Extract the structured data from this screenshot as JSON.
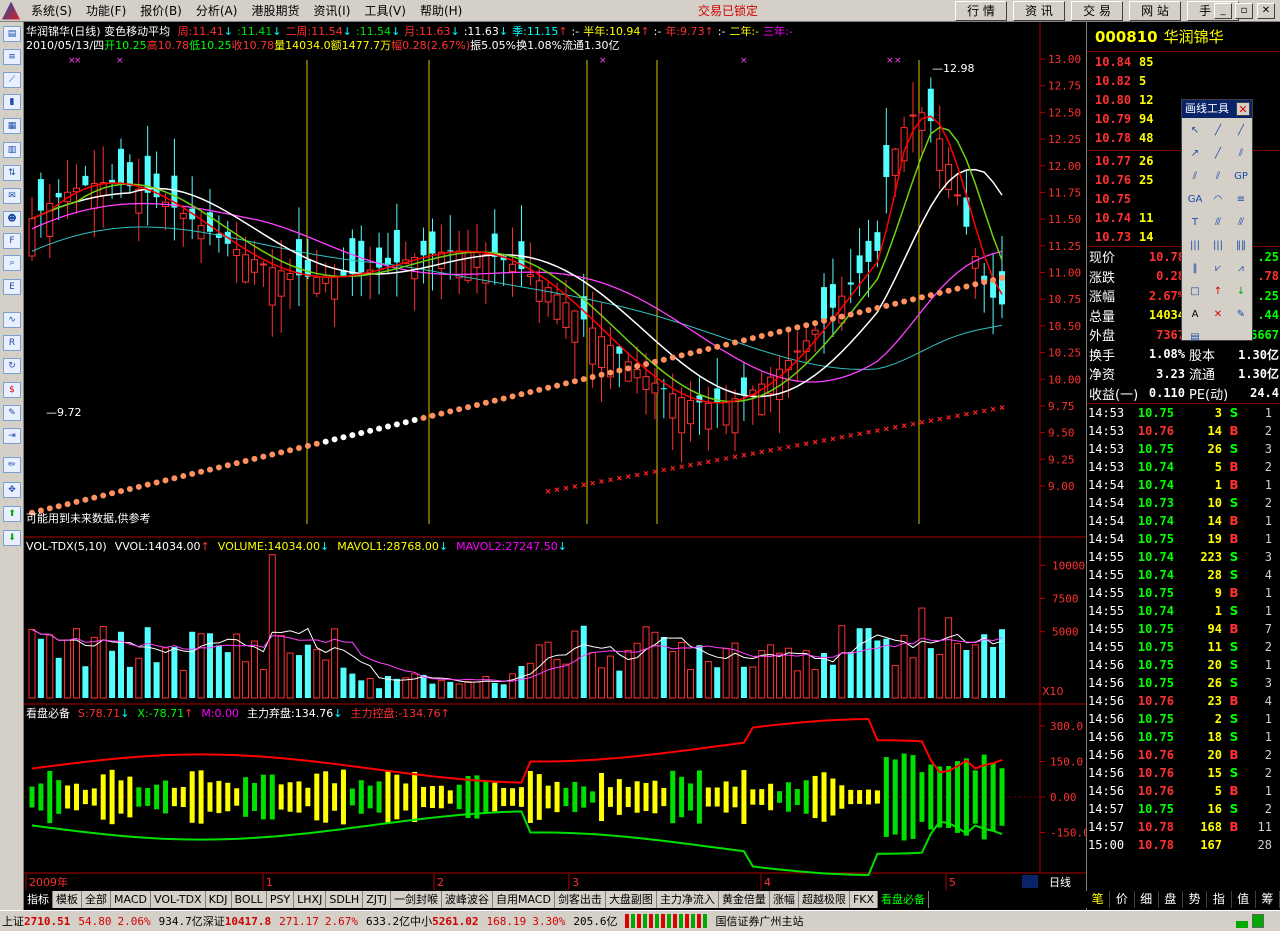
{
  "menu": {
    "items": [
      "系统(S)",
      "功能(F)",
      "报价(B)",
      "分析(A)",
      "港股期货",
      "资讯(I)",
      "工具(V)",
      "帮助(H)"
    ],
    "lock_status": "交易已锁定",
    "right_buttons": [
      "行 情",
      "资 讯",
      "交 易",
      "网 站",
      "手 机"
    ]
  },
  "toolbar_icons": [
    "quote-icon",
    "list-icon",
    "line-chart-icon",
    "candle-icon",
    "report-icon",
    "table-icon",
    "sort-icon",
    "mail-icon",
    "people-icon",
    "f10-icon",
    "zoom-icon",
    "etf-icon",
    "wave-icon",
    "rsi-icon",
    "refresh-icon",
    "dollar-icon",
    "wrench-icon",
    "exit-icon",
    "pencil-icon",
    "move-icon",
    "up-arrow-icon",
    "down-arrow-icon"
  ],
  "header": {
    "title": "华润锦华(日线)",
    "indicator_name": "变色移动平均",
    "ma_values": [
      {
        "label": "周:11.41",
        "color": "#ff3030",
        "arrow": "↓"
      },
      {
        "label": ":11.41",
        "color": "#00e000",
        "arrow": "↓"
      },
      {
        "label": "二周:11.54",
        "color": "#ff3030",
        "arrow": "↓"
      },
      {
        "label": ":11.54",
        "color": "#00e000",
        "arrow": "↓"
      },
      {
        "label": "月:11.63",
        "color": "#ff3030",
        "arrow": "↓"
      },
      {
        "label": ":11.63",
        "color": "#ffffff",
        "arrow": "↓"
      },
      {
        "label": "季:11.15",
        "color": "#00ffff",
        "arrow": "↑"
      },
      {
        "label": ":-",
        "color": "#ffffff",
        "arrow": ""
      },
      {
        "label": "半年:10.94",
        "color": "#ffff00",
        "arrow": "↑"
      },
      {
        "label": ":-",
        "color": "#ffffff",
        "arrow": ""
      },
      {
        "label": "年:9.73",
        "color": "#ff3030",
        "arrow": "↑"
      },
      {
        "label": ":-",
        "color": "#ffffff",
        "arrow": ""
      },
      {
        "label": "二年:-",
        "color": "#ffff00",
        "arrow": ""
      },
      {
        "label": "三年:-",
        "color": "#ff00ff",
        "arrow": ""
      }
    ],
    "info_line": "2010/05/13/四",
    "info_items": [
      {
        "label": "开10.25",
        "color": "#00ff00"
      },
      {
        "label": "高10.78",
        "color": "#ff3030"
      },
      {
        "label": "低10.25",
        "color": "#00ff00"
      },
      {
        "label": "收10.78",
        "color": "#ff3030"
      },
      {
        "label": "量14034.0",
        "color": "#ffff00"
      },
      {
        "label": "额1477.7万",
        "color": "#ffff00"
      },
      {
        "label": "幅0.28(2.67%)",
        "color": "#ff3030"
      },
      {
        "label": "振5.05%",
        "color": "#ffffff"
      },
      {
        "label": "换1.08%",
        "color": "#ffffff"
      },
      {
        "label": "流通1.30亿",
        "color": "#ffffff"
      }
    ]
  },
  "main_chart": {
    "y_ticks": [
      "13.00",
      "12.75",
      "12.50",
      "12.25",
      "12.00",
      "11.75",
      "11.50",
      "11.25",
      "11.00",
      "10.75",
      "10.50",
      "10.25",
      "10.00",
      "9.75",
      "9.50",
      "9.25",
      "9.00"
    ],
    "high_label": "12.98",
    "low_label": "9.72",
    "note": "可能用到未来数据,供参考"
  },
  "volume_chart": {
    "header": [
      {
        "label": "VOL-TDX(5,10)",
        "color": "#ffffff"
      },
      {
        "label": "VVOL:14034.00",
        "color": "#ffffff",
        "arrow": "↑"
      },
      {
        "label": "VOLUME:14034.00",
        "color": "#ffff00",
        "arrow": "↓"
      },
      {
        "label": "MAVOL1:28768.00",
        "color": "#ffff00",
        "arrow": "↓"
      },
      {
        "label": "MAVOL2:27247.50",
        "color": "#ff00ff",
        "arrow": "↓"
      }
    ],
    "y_ticks": [
      "10000",
      "7500",
      "5000"
    ],
    "multiplier": "X10"
  },
  "osc_chart": {
    "header": [
      {
        "label": "看盘必备",
        "color": "#ffffff"
      },
      {
        "label": "S:78.71",
        "color": "#ff3030",
        "arrow": "↓"
      },
      {
        "label": "X:-78.71",
        "color": "#00ff00",
        "arrow": "↑"
      },
      {
        "label": "M:0.00",
        "color": "#ff00ff"
      },
      {
        "label": "主力弃盘:134.76",
        "color": "#ffffff",
        "arrow": "↓"
      },
      {
        "label": "主力控盘:-134.76",
        "color": "#ff3030",
        "arrow": "↑"
      }
    ],
    "y_ticks": [
      "300.0",
      "150.0",
      "0.00",
      "-150.0"
    ]
  },
  "timeline": {
    "labels": [
      "2009年",
      "1",
      "2",
      "3",
      "4",
      "5"
    ],
    "period": "日线"
  },
  "bottom_tabs": [
    "指标",
    "模板",
    "全部",
    "MACD",
    "VOL-TDX",
    "KDJ",
    "BOLL",
    "PSY",
    "LHXJ",
    "SDLH",
    "ZJTJ",
    "一剑封喉",
    "波峰波谷",
    "自用MACD",
    "剑客出击",
    "大盘副图",
    "主力净流入",
    "黄金倍量",
    "涨幅",
    "超越极限",
    "FKX",
    "看盘必备"
  ],
  "status": {
    "sh_label": "上证",
    "sh_value": "2710.51",
    "sh_change": "54.80",
    "sh_pct": "2.06%",
    "sh_amount": "934.7亿",
    "sz_label": "深证",
    "sz_value": "10417.8",
    "sz_change": "271.17",
    "sz_pct": "2.67%",
    "sz_amount": "633.2亿",
    "sm_label": "中小",
    "sm_value": "5261.02",
    "sm_change": "168.19",
    "sm_pct": "3.30%",
    "sm_amount": "205.6亿",
    "server": "国信证券广州主站"
  },
  "right_panel": {
    "code": "000810",
    "name": "华润锦华",
    "sells": [
      {
        "price": "10.84",
        "vol": "85"
      },
      {
        "price": "10.82",
        "vol": "5"
      },
      {
        "price": "10.80",
        "vol": "12"
      },
      {
        "price": "10.79",
        "vol": "94"
      },
      {
        "price": "10.78",
        "vol": "48"
      }
    ],
    "buys": [
      {
        "price": "10.77",
        "vol": "26"
      },
      {
        "price": "10.76",
        "vol": "25"
      },
      {
        "price": "10.75",
        "vol": ""
      },
      {
        "price": "10.74",
        "vol": "11"
      },
      {
        "price": "10.73",
        "vol": "14"
      }
    ],
    "stats": [
      {
        "l1": "现价",
        "v1": "10.78",
        "c1": "#ff3030",
        "l2": "",
        "v2": ".25",
        "c2": "#00ff00"
      },
      {
        "l1": "涨跌",
        "v1": "0.28",
        "c1": "#ff3030",
        "l2": "",
        "v2": ".78",
        "c2": "#ff3030"
      },
      {
        "l1": "涨幅",
        "v1": "2.67%",
        "c1": "#ff3030",
        "l2": "",
        "v2": ".25",
        "c2": "#00ff00"
      },
      {
        "l1": "总量",
        "v1": "14034",
        "c1": "#ffff00",
        "l2": "",
        "v2": ".44",
        "c2": "#00ff00"
      },
      {
        "l1": "外盘",
        "v1": "7367",
        "c1": "#ff3030",
        "l2": "内盘",
        "v2": "6667",
        "c2": "#00ff00"
      },
      {
        "l1": "换手",
        "v1": "1.08%",
        "c1": "#ffffff",
        "l2": "股本",
        "v2": "1.30亿",
        "c2": "#ffffff"
      },
      {
        "l1": "净资",
        "v1": "3.23",
        "c1": "#ffffff",
        "l2": "流通",
        "v2": "1.30亿",
        "c2": "#ffffff"
      },
      {
        "l1": "收益(一)",
        "v1": "0.110",
        "c1": "#ffffff",
        "l2": "PE(动)",
        "v2": "24.4",
        "c2": "#ffffff"
      }
    ],
    "ticks": [
      [
        "14:53",
        "10.75",
        "3",
        "S",
        "1"
      ],
      [
        "14:53",
        "10.76",
        "14",
        "B",
        "2"
      ],
      [
        "14:53",
        "10.75",
        "26",
        "S",
        "3"
      ],
      [
        "14:53",
        "10.74",
        "5",
        "B",
        "2"
      ],
      [
        "14:54",
        "10.74",
        "1",
        "B",
        "1"
      ],
      [
        "14:54",
        "10.73",
        "10",
        "S",
        "2"
      ],
      [
        "14:54",
        "10.74",
        "14",
        "B",
        "1"
      ],
      [
        "14:54",
        "10.75",
        "19",
        "B",
        "1"
      ],
      [
        "14:55",
        "10.74",
        "223",
        "S",
        "3"
      ],
      [
        "14:55",
        "10.74",
        "28",
        "S",
        "4"
      ],
      [
        "14:55",
        "10.75",
        "9",
        "B",
        "1"
      ],
      [
        "14:55",
        "10.74",
        "1",
        "S",
        "1"
      ],
      [
        "14:55",
        "10.75",
        "94",
        "B",
        "7"
      ],
      [
        "14:55",
        "10.75",
        "11",
        "S",
        "2"
      ],
      [
        "14:56",
        "10.75",
        "20",
        "S",
        "1"
      ],
      [
        "14:56",
        "10.75",
        "26",
        "S",
        "3"
      ],
      [
        "14:56",
        "10.76",
        "23",
        "B",
        "4"
      ],
      [
        "14:56",
        "10.75",
        "2",
        "S",
        "1"
      ],
      [
        "14:56",
        "10.75",
        "18",
        "S",
        "1"
      ],
      [
        "14:56",
        "10.76",
        "20",
        "B",
        "2"
      ],
      [
        "14:56",
        "10.76",
        "15",
        "S",
        "2"
      ],
      [
        "14:56",
        "10.76",
        "5",
        "B",
        "1"
      ],
      [
        "14:57",
        "10.75",
        "16",
        "S",
        "2"
      ],
      [
        "14:57",
        "10.78",
        "168",
        "B",
        "11"
      ],
      [
        "15:00",
        "10.78",
        "167",
        "",
        "28"
      ]
    ],
    "tabs": [
      "笔",
      "价",
      "细",
      "盘",
      "势",
      "指",
      "值",
      "筹"
    ]
  },
  "draw_tool": {
    "title": "画线工具",
    "tools": [
      "pointer-icon",
      "line-icon",
      "ray-icon",
      "arrow-line-icon",
      "segment-icon",
      "parallel-icon",
      "channel-icon",
      "trend-icon",
      "gp-icon",
      "ga-icon",
      "arc-icon",
      "fib-icon",
      "text-box-icon",
      "fan-icon",
      "gann-icon",
      "period-icon",
      "bars-icon",
      "grid-icon",
      "cycle-icon",
      "speed-icon",
      "gann-fan-icon",
      "rect-icon",
      "up-mark-icon",
      "down-mark-icon",
      "text-icon",
      "cross-icon",
      "note-icon",
      "list-mark-icon"
    ]
  },
  "colors": {
    "up": "#ff3030",
    "down": "#54ffff",
    "ma_red": "#ff0000",
    "ma_green": "#70d010",
    "ma_white": "#ffffff",
    "ma_pink": "#ff40ff",
    "ma_cyan": "#30c0c0",
    "sar": "#ff9060"
  }
}
